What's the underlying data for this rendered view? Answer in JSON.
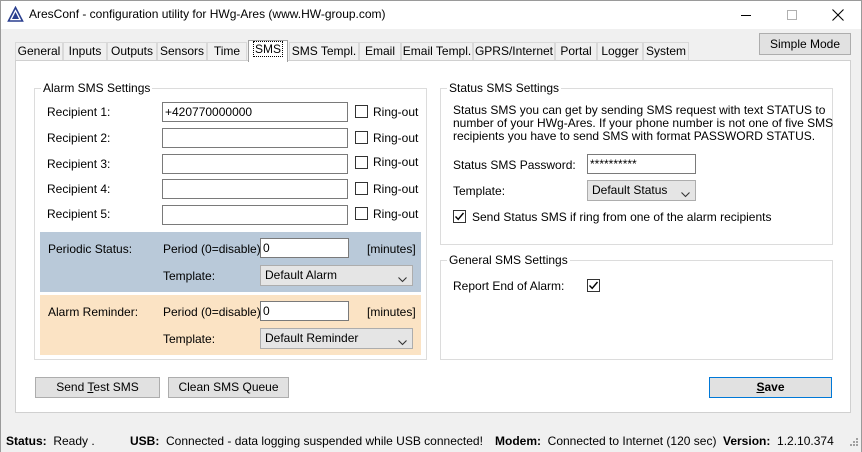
{
  "window": {
    "title": "AresConf - configuration utility for HWg-Ares (www.HW-group.com)",
    "icons": {
      "app": "triangle-logo-icon",
      "minimize": "minimize-icon",
      "maximize": "maximize-icon",
      "close": "close-icon"
    }
  },
  "simple_mode_label": "Simple Mode",
  "tabs": [
    {
      "label": "General"
    },
    {
      "label": "Inputs"
    },
    {
      "label": "Outputs"
    },
    {
      "label": "Sensors"
    },
    {
      "label": "Time"
    },
    {
      "label": "SMS"
    },
    {
      "label": "SMS Templ."
    },
    {
      "label": "Email"
    },
    {
      "label": "Email Templ."
    },
    {
      "label": "GPRS/Internet"
    },
    {
      "label": "Portal"
    },
    {
      "label": "Logger"
    },
    {
      "label": "System"
    }
  ],
  "active_tab": "SMS",
  "alarm_sms": {
    "title": "Alarm SMS Settings",
    "recipients": [
      {
        "label": "Recipient 1:",
        "value": "+420770000000",
        "ringout_label": "Ring-out",
        "ringout": false
      },
      {
        "label": "Recipient 2:",
        "value": "",
        "ringout_label": "Ring-out",
        "ringout": false
      },
      {
        "label": "Recipient 3:",
        "value": "",
        "ringout_label": "Ring-out",
        "ringout": false
      },
      {
        "label": "Recipient 4:",
        "value": "",
        "ringout_label": "Ring-out",
        "ringout": false
      },
      {
        "label": "Recipient 5:",
        "value": "",
        "ringout_label": "Ring-out",
        "ringout": false
      }
    ],
    "periodic": {
      "label": "Periodic Status:",
      "period_label": "Period (0=disable):",
      "period_value": "0",
      "unit": "[minutes]",
      "template_label": "Template:",
      "template_value": "Default Alarm",
      "color": "#b9c9d9"
    },
    "reminder": {
      "label": "Alarm Reminder:",
      "period_label": "Period (0=disable):",
      "period_value": "0",
      "unit": "[minutes]",
      "template_label": "Template:",
      "template_value": "Default Reminder",
      "color": "#fbe3c4"
    }
  },
  "status_sms": {
    "title": "Status SMS Settings",
    "description_lines": [
      "Status SMS you can get by sending SMS request with text STATUS to",
      "number of your HWg-Ares. If your phone number is not one of five SMS",
      "recipients you have to send SMS with format PASSWORD STATUS."
    ],
    "password_label": "Status SMS Password:",
    "password_value": "**********",
    "template_label": "Template:",
    "template_value": "Default Status",
    "ring_checkbox_label": "Send Status SMS if ring from one of the alarm recipients",
    "ring_checked": true
  },
  "general_sms": {
    "title": "General SMS Settings",
    "report_end_label": "Report End of Alarm:",
    "report_end_checked": true
  },
  "buttons": {
    "send_test_pre": "Send ",
    "send_test_u": "T",
    "send_test_post": "est SMS",
    "clean_queue": "Clean SMS Queue",
    "save_u": "S",
    "save_post": "ave"
  },
  "statusbar": {
    "status_label": "Status:",
    "status_value": "Ready .",
    "usb_label": "USB:",
    "usb_value": "Connected - data logging suspended while USB connected!",
    "modem_label": "Modem:",
    "modem_value": "Connected to Internet (120 sec)",
    "version_label": "Version:",
    "version_value": "1.2.10.374"
  },
  "colors": {
    "accent": "#0078d7",
    "periodic_band": "#b9c9d9",
    "reminder_band": "#fbe3c4"
  }
}
